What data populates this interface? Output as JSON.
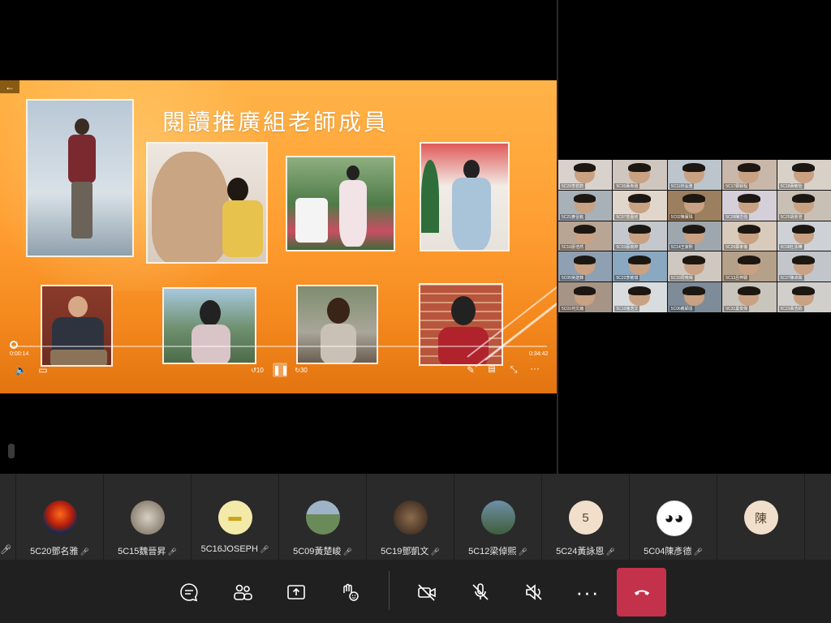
{
  "slide": {
    "title": "閱讀推廣組老師成員",
    "back_label": "←",
    "time_elapsed": "0:00:14",
    "time_total": "0:34:42",
    "rewind_label": "10",
    "forward_label": "30",
    "progress_fraction": 0.007
  },
  "grid_tiles": [
    {
      "name": "5C29李若蔚"
    },
    {
      "name": "5C30黃希翹"
    },
    {
      "name": "5C11林泓雅"
    },
    {
      "name": "5C17鄭穎程"
    },
    {
      "name": "5C18黃敏怡"
    },
    {
      "name": "5C21麥晉銘"
    },
    {
      "name": "5C07曾嘉欣"
    },
    {
      "name": "5C02陳寶珠"
    },
    {
      "name": "5C28陳志強"
    },
    {
      "name": "5C25胡景澄"
    },
    {
      "name": "5C16廖浩然"
    },
    {
      "name": "5C03蔡婉婷"
    },
    {
      "name": "5C14王家熙"
    },
    {
      "name": "5C26鄭孝儀"
    },
    {
      "name": "5C08杜泳樺"
    },
    {
      "name": "5C05吳建鋒"
    },
    {
      "name": "5C22李敏琪"
    },
    {
      "name": "5C33周曉晴"
    },
    {
      "name": "5C13呂梓聰"
    },
    {
      "name": "5C27陳卓霖"
    },
    {
      "name": "5C01何文瀚"
    },
    {
      "name": "5C10施浩文"
    },
    {
      "name": "5C06戴穎恩"
    },
    {
      "name": "5C31葉俊傑"
    },
    {
      "name": "5C23黃浩鈞"
    }
  ],
  "participants": [
    {
      "name": "5C20鄧名雅",
      "avatar": "volcano"
    },
    {
      "name": "5C15魏晉昇",
      "avatar": "cat"
    },
    {
      "name": "5C16JOSEPH",
      "avatar": "gun"
    },
    {
      "name": "5C09黃楚峻",
      "avatar": "landscape"
    },
    {
      "name": "5C19鄧凱文",
      "avatar": "animal"
    },
    {
      "name": "5C12梁倬熙",
      "avatar": "boy"
    },
    {
      "name": "5C24黃詠恩",
      "avatar": "initial",
      "initial": "5"
    },
    {
      "name": "5C04陳彥德",
      "avatar": "panda"
    },
    {
      "name": "",
      "avatar": "initial",
      "initial": "陳"
    }
  ],
  "toolbar": {
    "chat": "chat-icon",
    "people": "people-icon",
    "share": "share-icon",
    "react": "react-icon",
    "camera": "camera-off-icon",
    "mic": "mic-off-icon",
    "speaker": "speaker-off-icon",
    "more": "more-icon",
    "hangup": "hangup-icon"
  },
  "colors": {
    "hangup": "#c4314b",
    "accent": "#ff9f33"
  }
}
